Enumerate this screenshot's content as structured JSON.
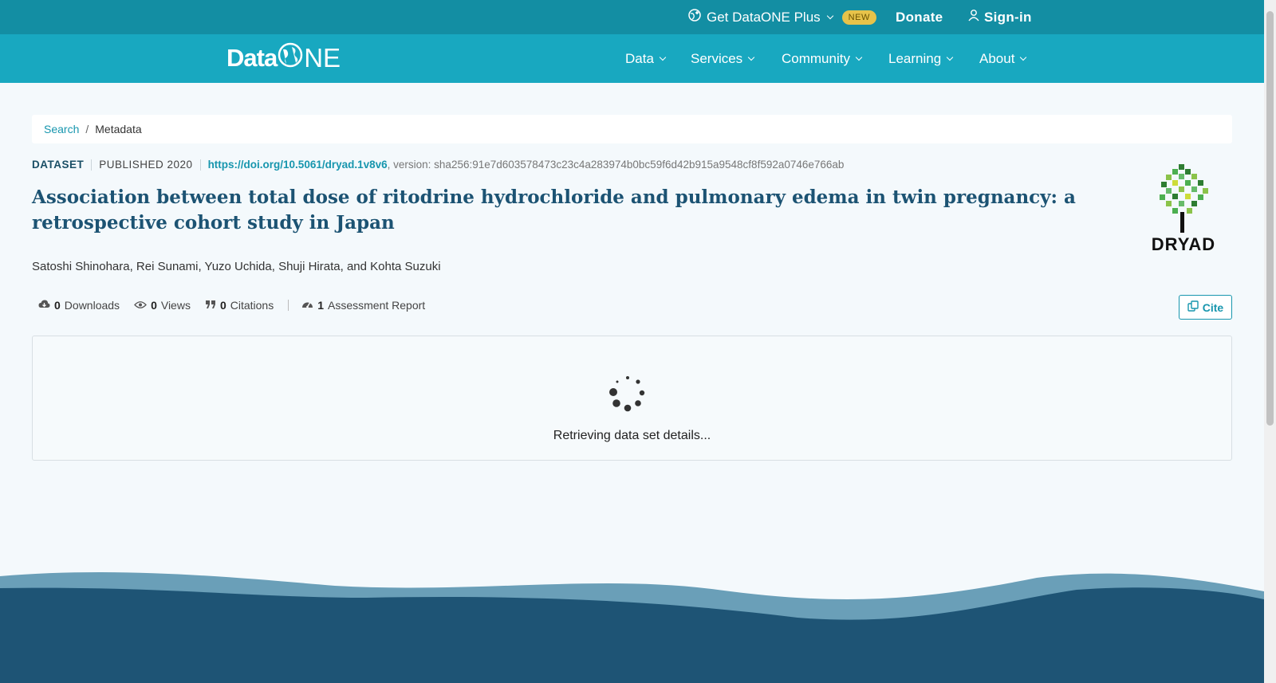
{
  "topbar": {
    "plus_label": "Get DataONE Plus",
    "new_badge": "NEW",
    "donate_label": "Donate",
    "signin_label": "Sign-in"
  },
  "logo": {
    "left": "Data",
    "right": "NE"
  },
  "nav": {
    "items": [
      {
        "label": "Data"
      },
      {
        "label": "Services"
      },
      {
        "label": "Community"
      },
      {
        "label": "Learning"
      },
      {
        "label": "About"
      }
    ]
  },
  "breadcrumb": {
    "search": "Search",
    "sep": "/",
    "current": "Metadata"
  },
  "dataset": {
    "type": "DATASET",
    "published": "PUBLISHED 2020",
    "doi": "https://doi.org/10.5061/dryad.1v8v6",
    "version": ", version: sha256:91e7d603578473c23c4a283974b0bc59f6d42b915a9548cf8f592a0746e766ab",
    "title": "Association between total dose of ritodrine hydrochloride and pulmonary edema in twin pregnancy: a retrospective cohort study in Japan",
    "authors": "Satoshi Shinohara, Rei Sunami, Yuzo Uchida, Shuji Hirata, and Kohta Suzuki",
    "repository": "DRYAD"
  },
  "metrics": {
    "downloads_count": "0",
    "downloads_label": "Downloads",
    "views_count": "0",
    "views_label": "Views",
    "citations_count": "0",
    "citations_label": "Citations",
    "assessment_count": "1",
    "assessment_label": "Assessment Report"
  },
  "cite_label": "Cite",
  "loading_text": "Retrieving data set details...",
  "colors": {
    "topbar": "#138ea3",
    "navbar": "#18a8c0",
    "title": "#1c5373",
    "link": "#1796ae",
    "wave_light": "#6a9fb8",
    "wave_dark": "#1e5475"
  }
}
